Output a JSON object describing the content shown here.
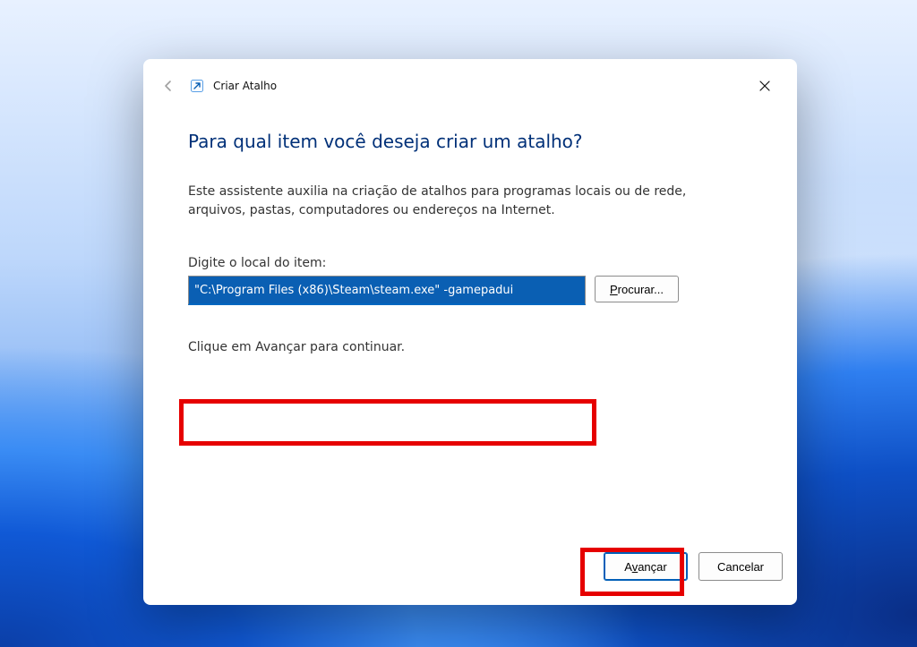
{
  "wizard": {
    "title": "Criar Atalho",
    "heading": "Para qual item você deseja criar um atalho?",
    "description": "Este assistente auxilia na criação de atalhos para programas locais ou de rede, arquivos, pastas, computadores ou endereços na Internet.",
    "field_label": "Digite o local do item:",
    "path_value": "\"C:\\Program Files (x86)\\Steam\\steam.exe\" -gamepadui",
    "browse_label_pre": "P",
    "browse_label_rest": "rocurar...",
    "continue_hint": "Clique em Avançar para continuar.",
    "next_label_pre": "A",
    "next_label_mid": "v",
    "next_label_rest": "ançar",
    "cancel_label": "Cancelar"
  }
}
